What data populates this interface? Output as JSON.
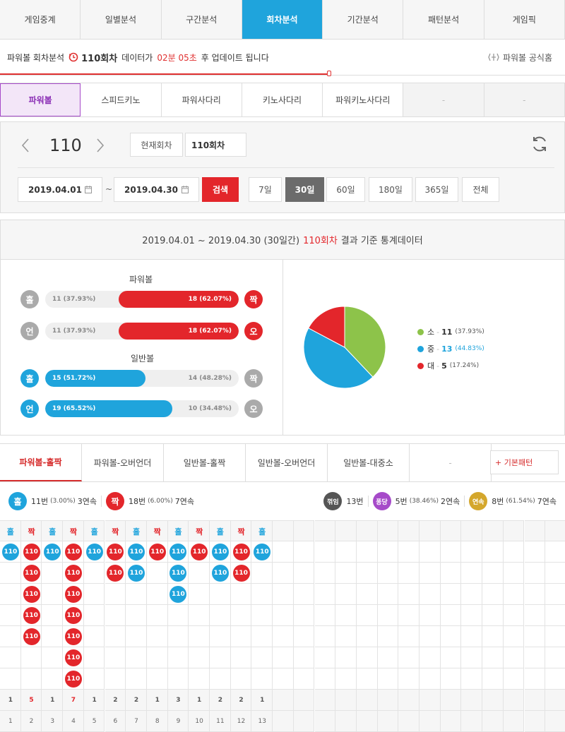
{
  "nav": [
    "게임중계",
    "일별분석",
    "구간분석",
    "회차분석",
    "기간분석",
    "패턴분석",
    "게임픽"
  ],
  "nav_active": 3,
  "info": {
    "prefix": "파워볼 회차분석",
    "round": "110회차",
    "mid": "데이터가",
    "timer": "02분 05초",
    "suffix": "후 업데이트 됩니다",
    "home_link": "파워볼 공식홈"
  },
  "subnav": [
    "파워볼",
    "스피드키노",
    "파워사다리",
    "키노사다리",
    "파워키노사다리",
    "-",
    "-"
  ],
  "control": {
    "round_value": "110",
    "current_round_btn": "현재회차",
    "round_input": "110회차",
    "date_from": "2019.04.01",
    "date_to": "2019.04.30",
    "tilde": "~",
    "search_btn": "검색",
    "periods": [
      "7일",
      "30일",
      "60일",
      "180일",
      "365일",
      "전체"
    ],
    "period_active": 1
  },
  "stats": {
    "head_prefix": "2019.04.01 ~ 2019.04.30 (30일간)",
    "head_round": "110회차",
    "head_suffix": "결과 기준 통계데이터",
    "powerball_title": "파워볼",
    "normal_title": "일반볼",
    "rows": [
      {
        "left_icon": "홀",
        "right_icon": "짝",
        "left_text": "11 (37.93%)",
        "right_text": "18 (62.07%)",
        "left_pct": 37.93,
        "winner": "right",
        "color": "#e3262b",
        "left_icon_color": "#aaaaaa",
        "right_icon_color": "#e3262b"
      },
      {
        "left_icon": "언",
        "right_icon": "오",
        "left_text": "11 (37.93%)",
        "right_text": "18 (62.07%)",
        "left_pct": 37.93,
        "winner": "right",
        "color": "#e3262b",
        "left_icon_color": "#aaaaaa",
        "right_icon_color": "#e3262b"
      },
      {
        "left_icon": "홀",
        "right_icon": "짝",
        "left_text": "15 (51.72%)",
        "right_text": "14 (48.28%)",
        "left_pct": 51.72,
        "winner": "left",
        "color": "#1fa4dc",
        "left_icon_color": "#1fa4dc",
        "right_icon_color": "#aaaaaa"
      },
      {
        "left_icon": "언",
        "right_icon": "오",
        "left_text": "19 (65.52%)",
        "right_text": "10 (34.48%)",
        "left_pct": 65.52,
        "winner": "left",
        "color": "#1fa4dc",
        "left_icon_color": "#1fa4dc",
        "right_icon_color": "#aaaaaa"
      }
    ],
    "pie": [
      {
        "label": "소",
        "count": "11",
        "pct": "(37.93%)",
        "value": 37.93,
        "color": "#8dc34a"
      },
      {
        "label": "중",
        "count": "13",
        "pct": "(44.83%)",
        "value": 44.83,
        "color": "#1fa4dc"
      },
      {
        "label": "대",
        "count": "5",
        "pct": "(17.24%)",
        "value": 17.24,
        "color": "#e3262b"
      }
    ],
    "dash": "-"
  },
  "pattern_tabs": [
    "파워볼-홀짝",
    "파워볼-오버언더",
    "일반볼-홀짝",
    "일반볼-오버언더",
    "일반볼-대중소",
    "-"
  ],
  "pattern_tab_active": 0,
  "basic_pattern_btn": "+ 기본패턴",
  "summary": {
    "odd_icon": "홀",
    "odd_text": "11번",
    "odd_pct": "(3.00%)",
    "odd_streak": "3연속",
    "even_icon": "짝",
    "even_text": "18번",
    "even_pct": "(6.00%)",
    "even_streak": "7연속",
    "break_icon": "꺾임",
    "break_text": "13번",
    "pong_icon": "퐁당",
    "pong_text": "5번",
    "pong_pct": "(38.46%)",
    "pong_streak": "2연속",
    "cont_icon": "연속",
    "cont_text": "8번",
    "cont_pct": "(61.54%)",
    "cont_streak": "7연속"
  },
  "pattern": {
    "ball_label": "110",
    "columns": [
      {
        "head": "홀",
        "type": "odd",
        "count": 1,
        "total": "1",
        "index": "1"
      },
      {
        "head": "짝",
        "type": "even",
        "count": 5,
        "total": "5",
        "index": "2"
      },
      {
        "head": "홀",
        "type": "odd",
        "count": 1,
        "total": "1",
        "index": "3"
      },
      {
        "head": "짝",
        "type": "even",
        "count": 7,
        "total": "7",
        "index": "4"
      },
      {
        "head": "홀",
        "type": "odd",
        "count": 1,
        "total": "1",
        "index": "5"
      },
      {
        "head": "짝",
        "type": "even",
        "count": 2,
        "total": "2",
        "index": "6"
      },
      {
        "head": "홀",
        "type": "odd",
        "count": 2,
        "total": "2",
        "index": "7"
      },
      {
        "head": "짝",
        "type": "even",
        "count": 1,
        "total": "1",
        "index": "8"
      },
      {
        "head": "홀",
        "type": "odd",
        "count": 3,
        "total": "3",
        "index": "9"
      },
      {
        "head": "짝",
        "type": "even",
        "count": 1,
        "total": "1",
        "index": "10"
      },
      {
        "head": "홀",
        "type": "odd",
        "count": 2,
        "total": "2",
        "index": "11"
      },
      {
        "head": "짝",
        "type": "even",
        "count": 2,
        "total": "2",
        "index": "12"
      },
      {
        "head": "홀",
        "type": "odd",
        "count": 1,
        "total": "1",
        "index": "13"
      }
    ],
    "odd_color": "#1fa4dc",
    "even_color": "#e3262b"
  }
}
